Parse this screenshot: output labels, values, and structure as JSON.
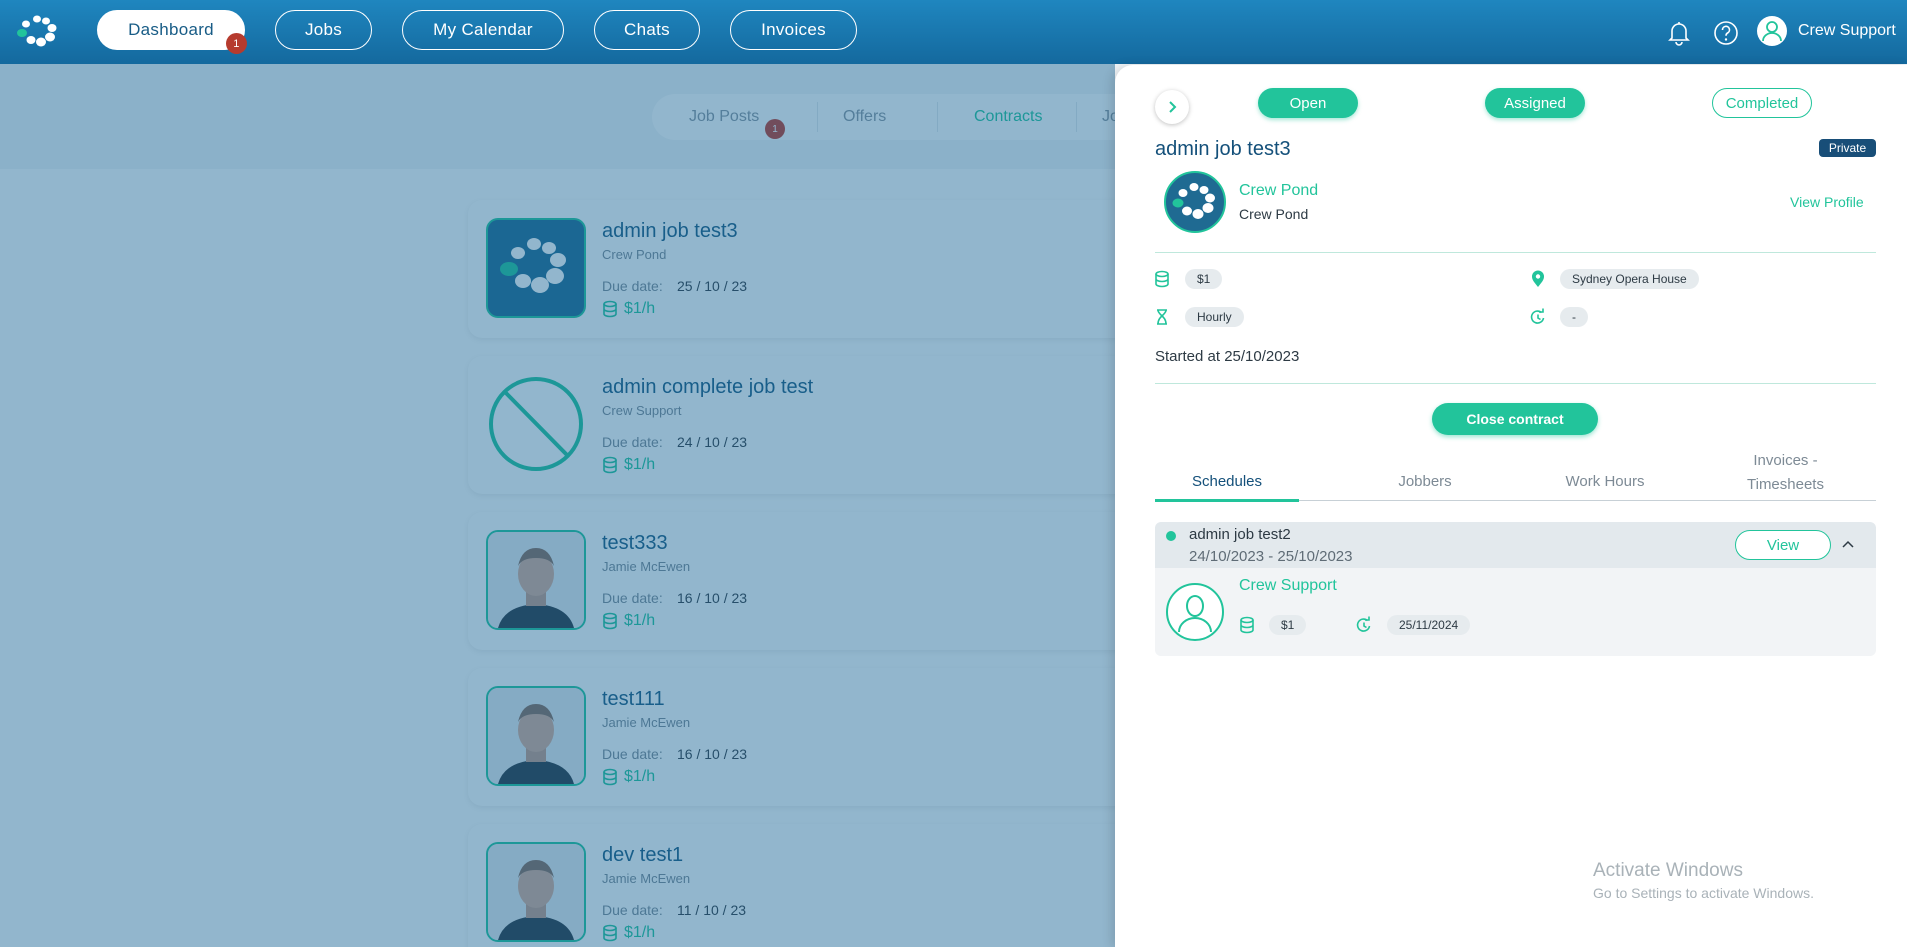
{
  "nav": {
    "dashboard": "Dashboard",
    "dashboard_badge": "1",
    "jobs": "Jobs",
    "calendar": "My Calendar",
    "chats": "Chats",
    "invoices": "Invoices",
    "user_name": "Crew Support"
  },
  "subtabs": {
    "job_posts": "Job Posts",
    "job_posts_badge": "1",
    "offers": "Offers",
    "contracts": "Contracts",
    "partial": "Jo"
  },
  "jobs": [
    {
      "title": "admin job test3",
      "company": "Crew Pond",
      "due_label": "Due date:",
      "due": "25 / 10 / 23",
      "rate": "$1/h",
      "thumb": "crew-pond-logo"
    },
    {
      "title": "admin complete job test",
      "company": "Crew Support",
      "due_label": "Due date:",
      "due": "24 / 10 / 23",
      "rate": "$1/h",
      "thumb": "no-image-icon"
    },
    {
      "title": "test333",
      "company": "Jamie McEwen",
      "due_label": "Due date:",
      "due": "16 / 10 / 23",
      "rate": "$1/h",
      "thumb": "person-photo"
    },
    {
      "title": "test111",
      "company": "Jamie McEwen",
      "due_label": "Due date:",
      "due": "16 / 10 / 23",
      "rate": "$1/h",
      "thumb": "person-photo"
    },
    {
      "title": "dev test1",
      "company": "Jamie McEwen",
      "due_label": "Due date:",
      "due": "11 / 10 / 23",
      "rate": "$1/h",
      "thumb": "person-photo"
    }
  ],
  "panel": {
    "status": {
      "open": "Open",
      "assigned": "Assigned",
      "completed": "Completed"
    },
    "title": "admin job test3",
    "private": "Private",
    "company_name": "Crew Pond",
    "company_sub": "Crew Pond",
    "view_profile": "View Profile",
    "rate": "$1",
    "location": "Sydney Opera House",
    "type": "Hourly",
    "recurrence": "-",
    "started": "Started at 25/10/2023",
    "close_contract": "Close contract",
    "tabs": {
      "schedules": "Schedules",
      "jobbers": "Jobbers",
      "work_hours": "Work Hours",
      "invoices_1": "Invoices -",
      "invoices_2": "Timesheets"
    },
    "schedule": {
      "title": "admin job test2",
      "dates": "24/10/2023 - 25/10/2023",
      "view": "View",
      "jobber": "Crew Support",
      "rate": "$1",
      "date": "25/11/2024"
    }
  },
  "watermark": {
    "line1": "Activate Windows",
    "line2": "Go to Settings to activate Windows."
  },
  "colors": {
    "accent": "#22c49b",
    "nav": "#1a78b0",
    "overlay": "#186494",
    "title": "#14507a"
  }
}
